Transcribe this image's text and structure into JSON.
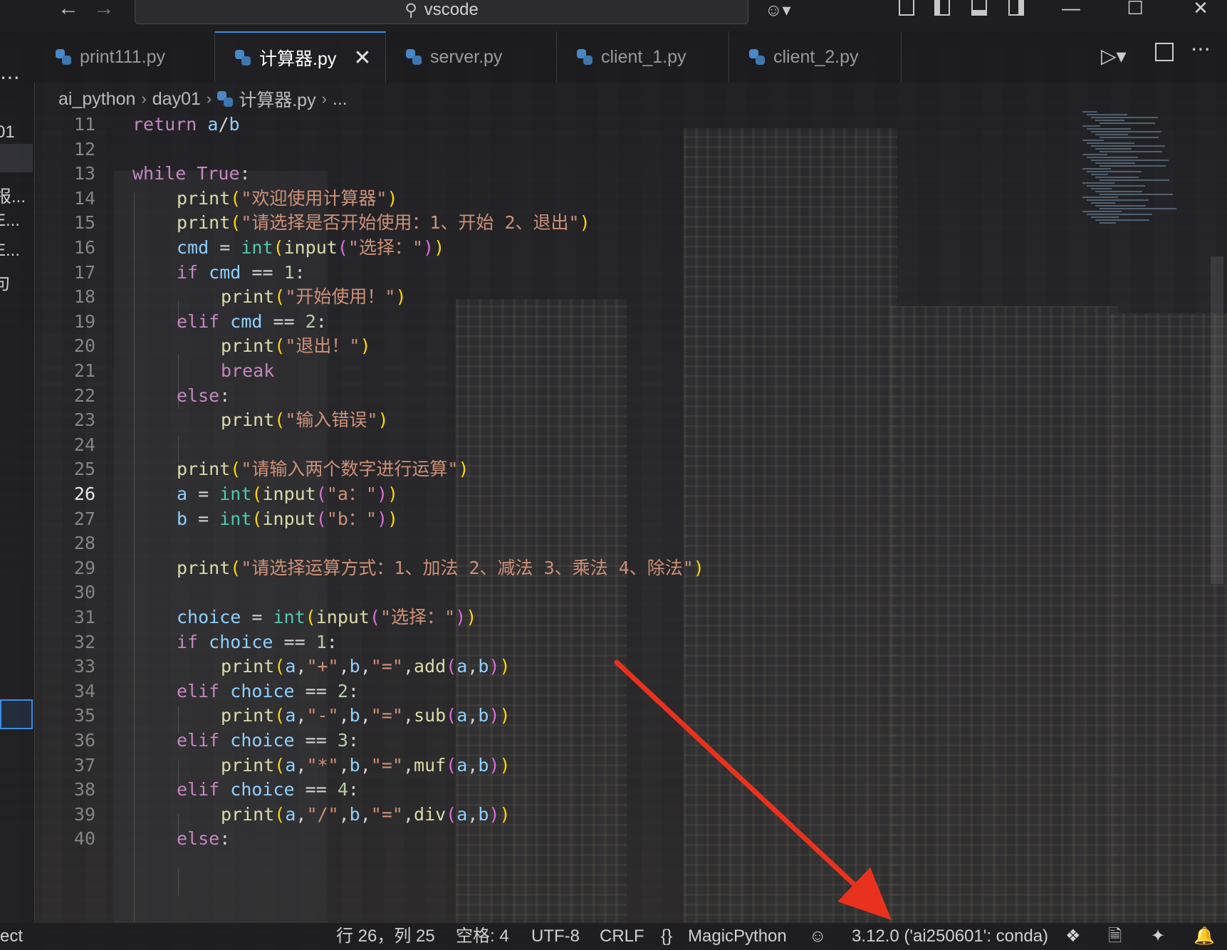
{
  "titlebar": {
    "search_text": "vscode",
    "nav_back_icon": "arrow-left-icon",
    "nav_forward_icon": "arrow-right-icon"
  },
  "tabs": [
    {
      "label": "print111.py",
      "active": false
    },
    {
      "label": "计算器.py",
      "active": true
    },
    {
      "label": "server.py",
      "active": false
    },
    {
      "label": "client_1.py",
      "active": false
    },
    {
      "label": "client_2.py",
      "active": false
    }
  ],
  "breadcrumb": {
    "items": [
      "ai_python",
      "day01",
      "计算器.py",
      "..."
    ]
  },
  "sidebar": {
    "visible_fragments": [
      "01",
      "报...",
      "E...",
      "E...",
      "句"
    ]
  },
  "editor": {
    "current_line": 26,
    "lines": [
      {
        "n": "11",
        "code": "return a/b"
      },
      {
        "n": "12",
        "code": ""
      },
      {
        "n": "13",
        "code": "while True:"
      },
      {
        "n": "14",
        "code": "print(\"欢迎使用计算器\")"
      },
      {
        "n": "15",
        "code": "print(\"请选择是否开始使用：1、开始 2、退出\")"
      },
      {
        "n": "16",
        "code": "cmd = int(input(\"选择：\"))"
      },
      {
        "n": "17",
        "code": "if cmd == 1:"
      },
      {
        "n": "18",
        "code": "print(\"开始使用！\")"
      },
      {
        "n": "19",
        "code": "elif cmd == 2:"
      },
      {
        "n": "20",
        "code": "print(\"退出！\")"
      },
      {
        "n": "21",
        "code": "break"
      },
      {
        "n": "22",
        "code": "else:"
      },
      {
        "n": "23",
        "code": "print(\"输入错误\")"
      },
      {
        "n": "24",
        "code": ""
      },
      {
        "n": "25",
        "code": "print(\"请输入两个数字进行运算\")"
      },
      {
        "n": "26",
        "code": "a = int(input(\"a：\"))"
      },
      {
        "n": "27",
        "code": "b = int(input(\"b：\"))"
      },
      {
        "n": "28",
        "code": ""
      },
      {
        "n": "29",
        "code": "print(\"请选择运算方式：1、加法 2、减法 3、乘法 4、除法\")"
      },
      {
        "n": "30",
        "code": ""
      },
      {
        "n": "31",
        "code": "choice = int(input(\"选择：\"))"
      },
      {
        "n": "32",
        "code": "if choice == 1:"
      },
      {
        "n": "33",
        "code": "print(a,\"+\",b,\"=\",add(a,b))"
      },
      {
        "n": "34",
        "code": "elif choice == 2:"
      },
      {
        "n": "35",
        "code": "print(a,\"-\",b,\"=\",sub(a,b))"
      },
      {
        "n": "36",
        "code": "elif choice == 3:"
      },
      {
        "n": "37",
        "code": "print(a,\"*\",b,\"=\",muf(a,b))"
      },
      {
        "n": "38",
        "code": "elif choice == 4:"
      },
      {
        "n": "39",
        "code": "print(a,\"/\",b,\"=\",div(a,b))"
      },
      {
        "n": "40",
        "code": "else:"
      }
    ]
  },
  "statusbar": {
    "left_fragment": "ect",
    "cursor_position": "行 26，列 25",
    "indentation": "空格: 4",
    "encoding": "UTF-8",
    "line_ending": "CRLF",
    "language_braces": "{}",
    "language": "MagicPython",
    "interpreter": "3.12.0 ('ai250601': conda)"
  },
  "colors": {
    "accent": "#3a8ee6",
    "keyword": "#4fa0f0",
    "control_keyword": "#c586c0",
    "string": "#ce9178",
    "builtin": "#4ec9b0",
    "function": "#dcdcaa",
    "annotation_arrow": "#e8321e"
  }
}
